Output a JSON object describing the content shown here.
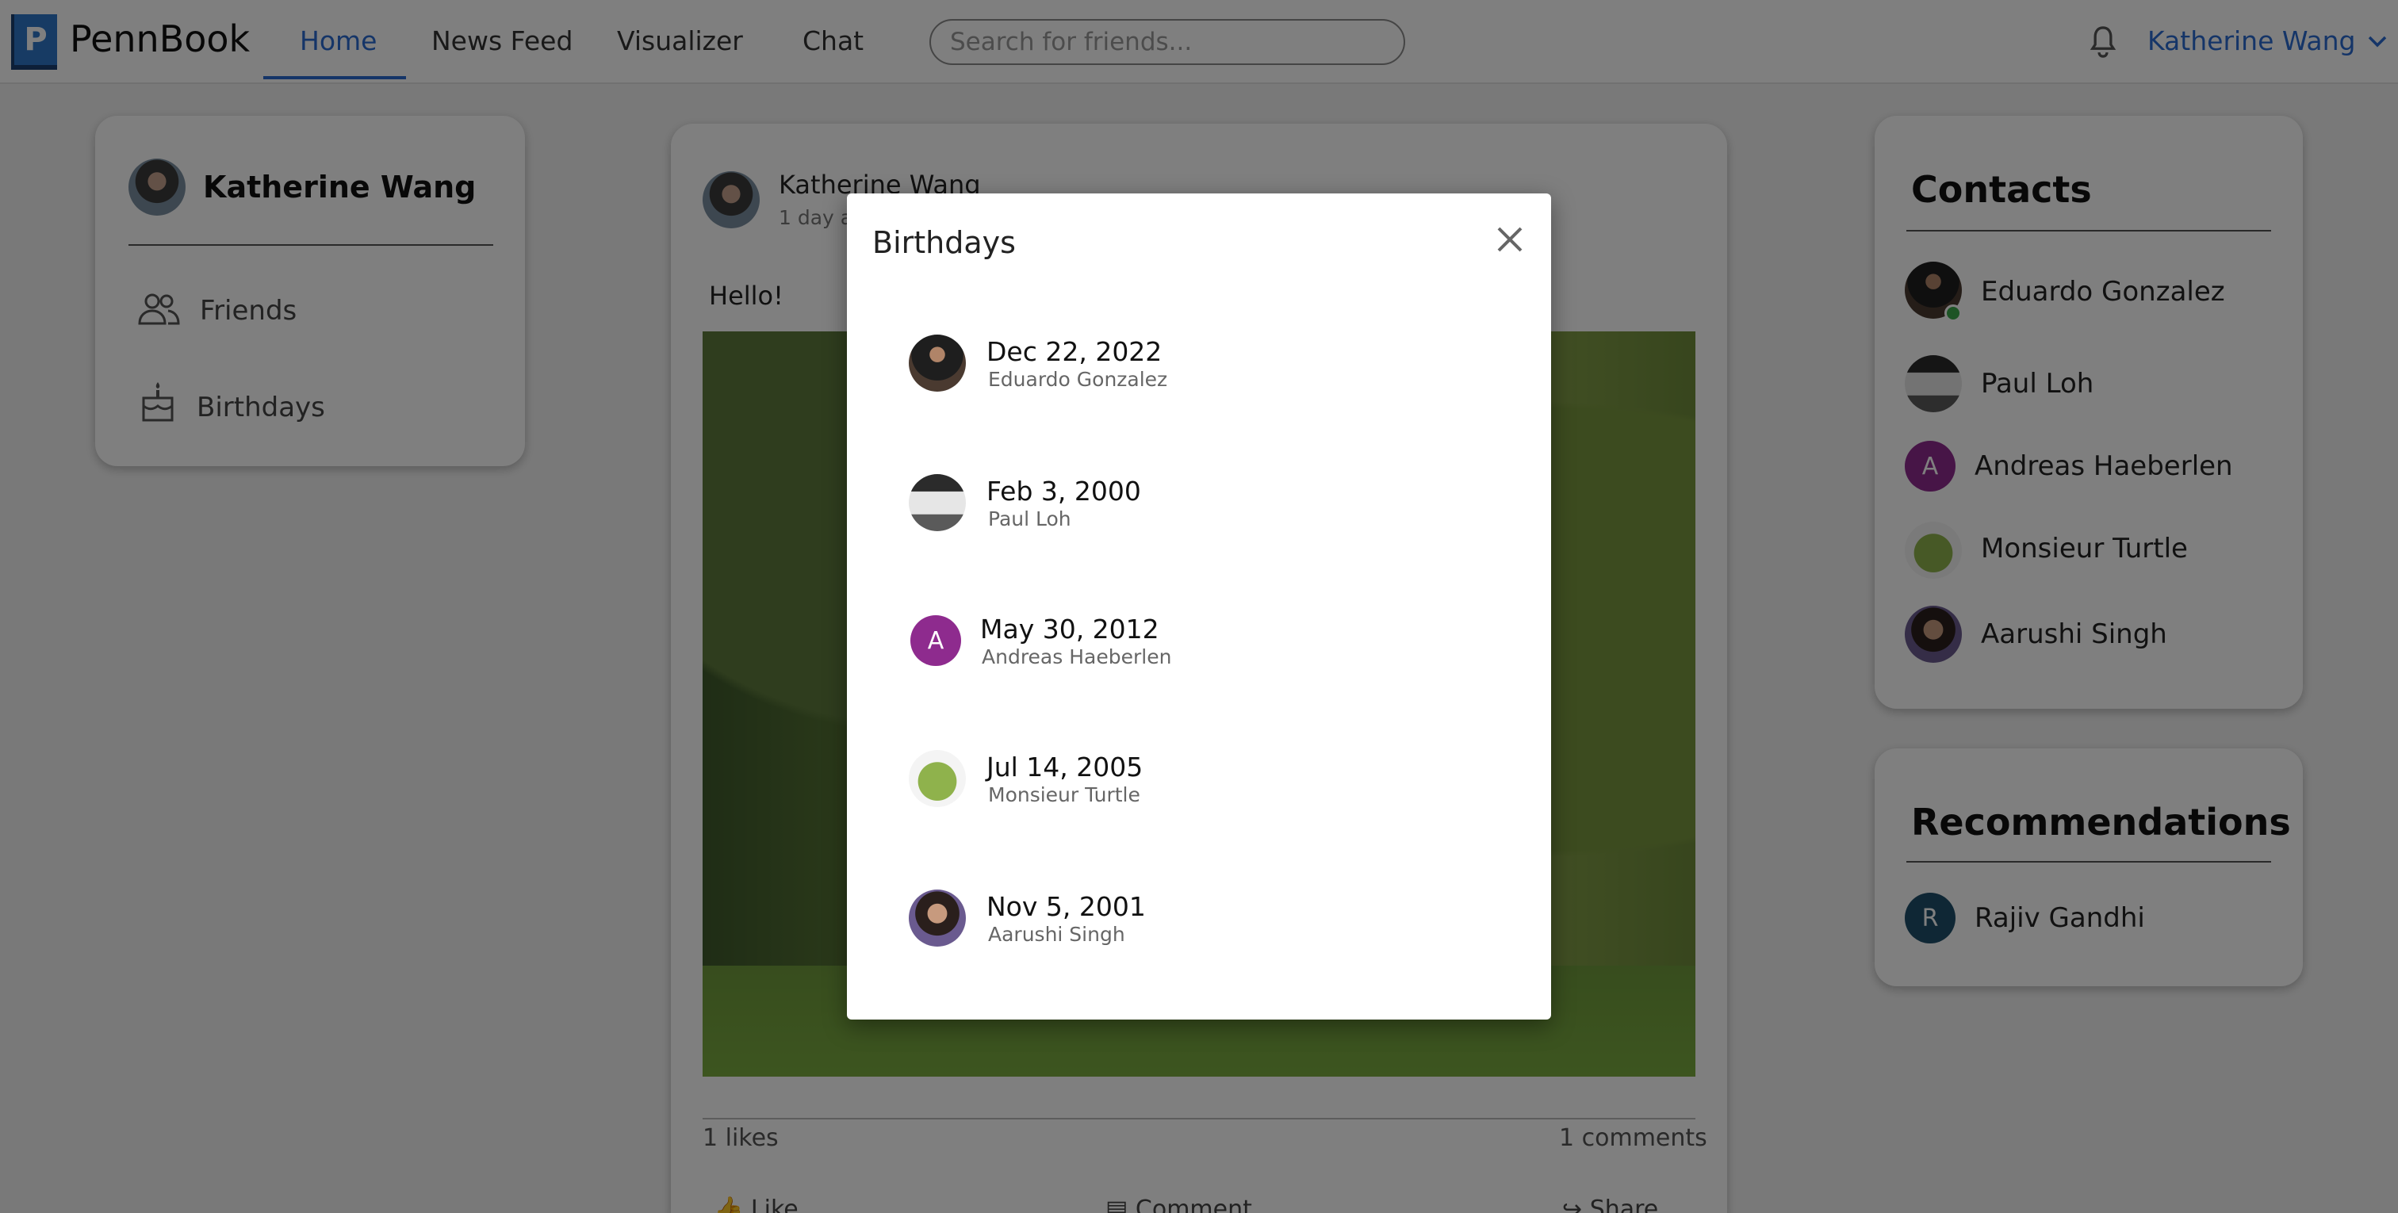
{
  "navbar": {
    "logo_letter": "P",
    "app_title": "PennBook",
    "tabs": [
      "Home",
      "News Feed",
      "Visualizer",
      "Chat"
    ],
    "search_placeholder": "Search for friends...",
    "user_name": "Katherine Wang"
  },
  "profile_card": {
    "name": "Katherine Wang",
    "items": [
      "Friends",
      "Birthdays"
    ]
  },
  "post": {
    "author": "Katherine Wang",
    "time_visible": "1 day a",
    "text": "Hello!",
    "likes": "1 likes",
    "comments": "1 comments",
    "actions": [
      "Like",
      "Comment",
      "Share"
    ]
  },
  "contacts": {
    "title": "Contacts",
    "items": [
      "Eduardo Gonzalez",
      "Paul Loh",
      "Andreas Haeberlen",
      "Monsieur Turtle",
      "Aarushi Singh"
    ],
    "andreas_initial": "A"
  },
  "recommendations": {
    "title": "Recommendations",
    "items": [
      "Rajiv Gandhi"
    ],
    "rajiv_initial": "R"
  },
  "modal": {
    "title": "Birthdays",
    "entries": [
      {
        "date": "Dec 22, 2022",
        "name": "Eduardo Gonzalez"
      },
      {
        "date": "Feb 3, 2000",
        "name": "Paul Loh"
      },
      {
        "date": "May 30, 2012",
        "name": "Andreas Haeberlen",
        "initial": "A"
      },
      {
        "date": "Jul 14, 2005",
        "name": "Monsieur Turtle"
      },
      {
        "date": "Nov 5, 2001",
        "name": "Aarushi Singh"
      }
    ]
  },
  "colors": {
    "accent": "#2a6bd1",
    "online": "#3ba84a",
    "andreas_avatar": "#8e2b8e",
    "rajiv_avatar": "#1f4f6a"
  }
}
